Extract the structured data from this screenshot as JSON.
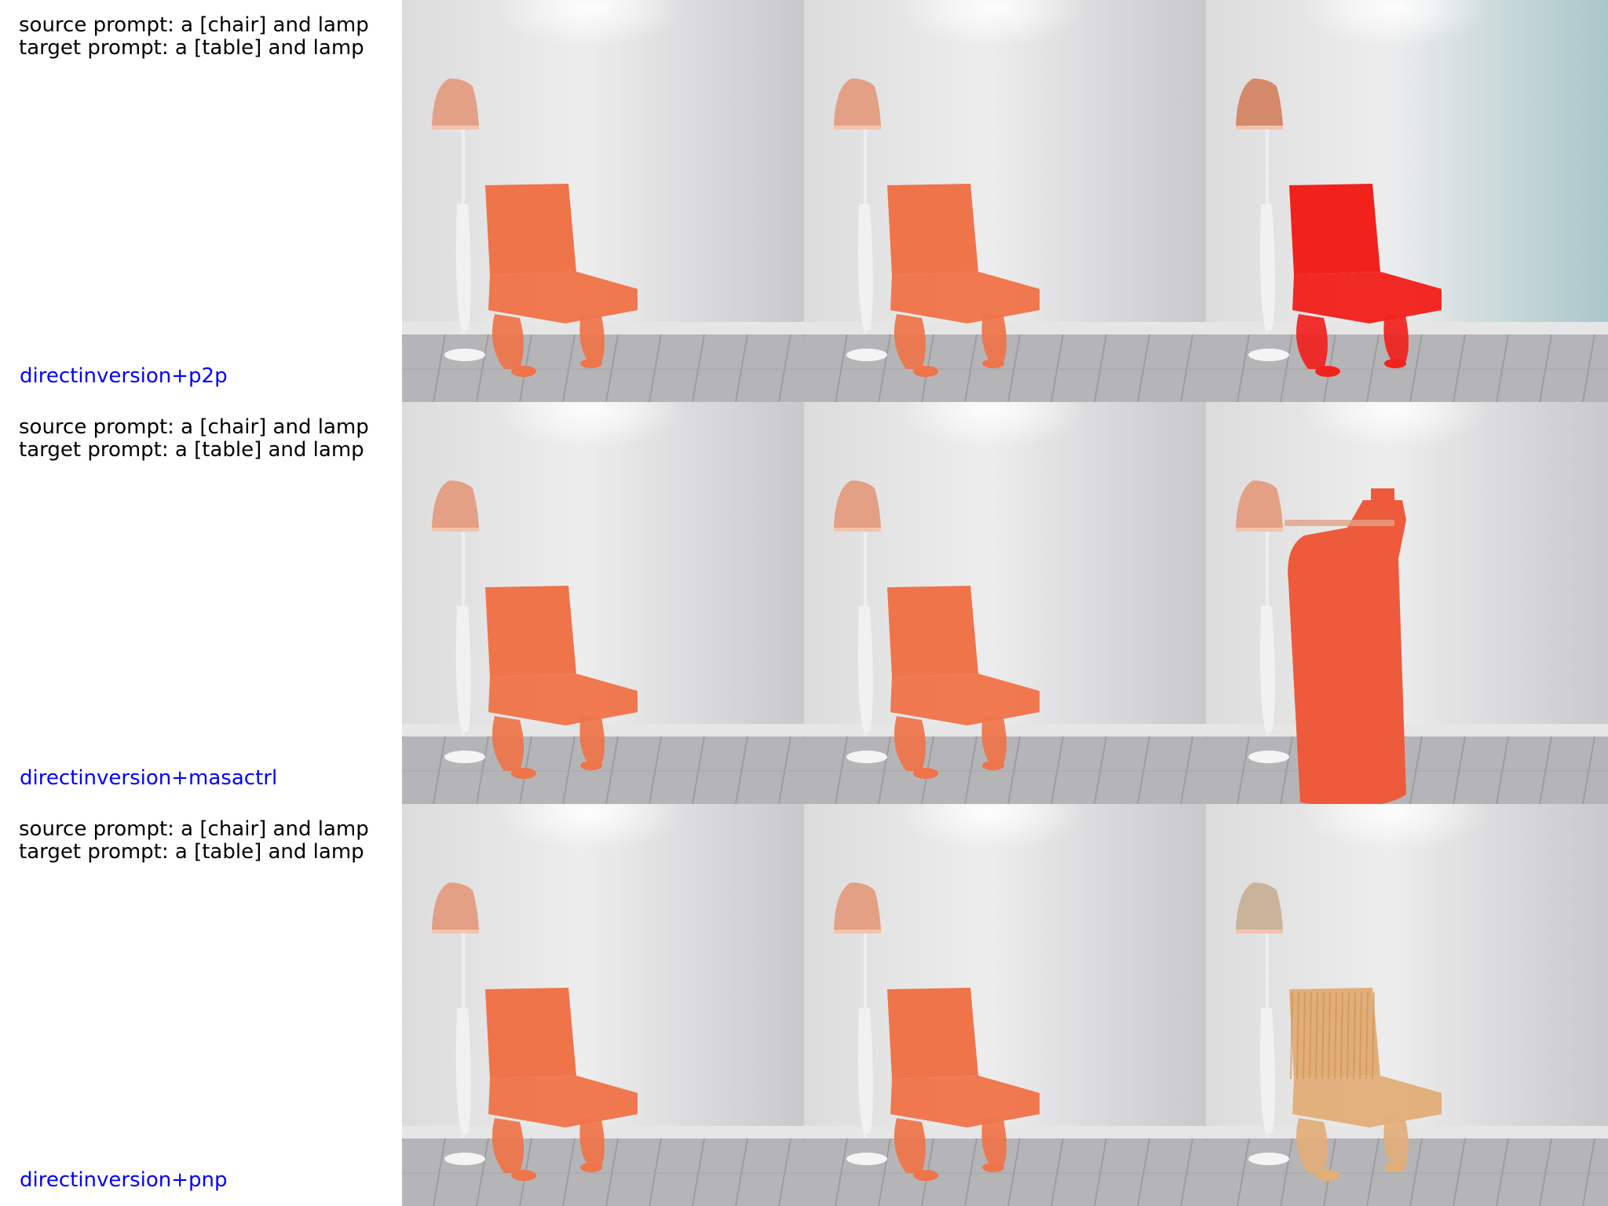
{
  "rows": [
    {
      "source_prompt": "source prompt: a [chair] and lamp",
      "target_prompt": "target prompt: a [table] and lamp",
      "method": "directinversion+p2p",
      "panels": [
        {
          "object": "chair",
          "chair_color": "#ef7449",
          "lamp_color": "#e3a085",
          "wall_tint": "neutral"
        },
        {
          "object": "chair",
          "chair_color": "#ef7449",
          "lamp_color": "#e3a085",
          "wall_tint": "neutral"
        },
        {
          "object": "chair",
          "chair_color": "#f1211c",
          "lamp_color": "#d4896a",
          "wall_tint": "teal"
        }
      ]
    },
    {
      "source_prompt": "source prompt: a [chair] and lamp",
      "target_prompt": "target prompt: a [table] and lamp",
      "method": "directinversion+masactrl",
      "panels": [
        {
          "object": "chair",
          "chair_color": "#ef7449",
          "lamp_color": "#e3a085",
          "wall_tint": "neutral"
        },
        {
          "object": "chair",
          "chair_color": "#ef7449",
          "lamp_color": "#e3a085",
          "wall_tint": "neutral"
        },
        {
          "object": "blob",
          "chair_color": "#ee5a3c",
          "lamp_color": "#e3a085",
          "wall_tint": "neutral"
        }
      ]
    },
    {
      "source_prompt": "source prompt: a [chair] and lamp",
      "target_prompt": "target prompt: a [table] and lamp",
      "method": "directinversion+pnp",
      "panels": [
        {
          "object": "chair",
          "chair_color": "#ef7449",
          "lamp_color": "#e3a085",
          "wall_tint": "neutral"
        },
        {
          "object": "chair",
          "chair_color": "#ef7449",
          "lamp_color": "#e3a085",
          "wall_tint": "neutral"
        },
        {
          "object": "wood-chair",
          "chair_color": "#e2ae78",
          "lamp_color": "#c9b39a",
          "wall_tint": "neutral"
        }
      ]
    }
  ]
}
